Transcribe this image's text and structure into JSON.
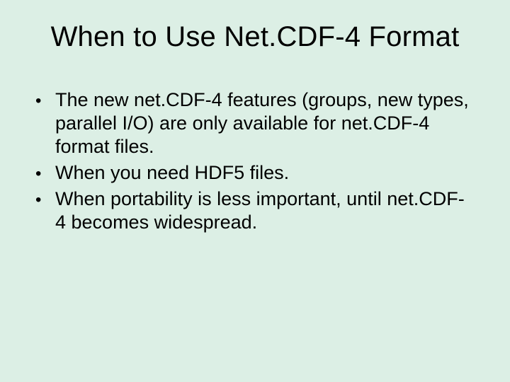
{
  "slide": {
    "title": "When to Use Net.CDF-4 Format",
    "bullets": [
      "The new net.CDF-4 features (groups, new types, parallel I/O) are only available for net.CDF-4 format files.",
      "When you need HDF5 files.",
      "When portability is less important, until net.CDF-4 becomes widespread."
    ]
  }
}
